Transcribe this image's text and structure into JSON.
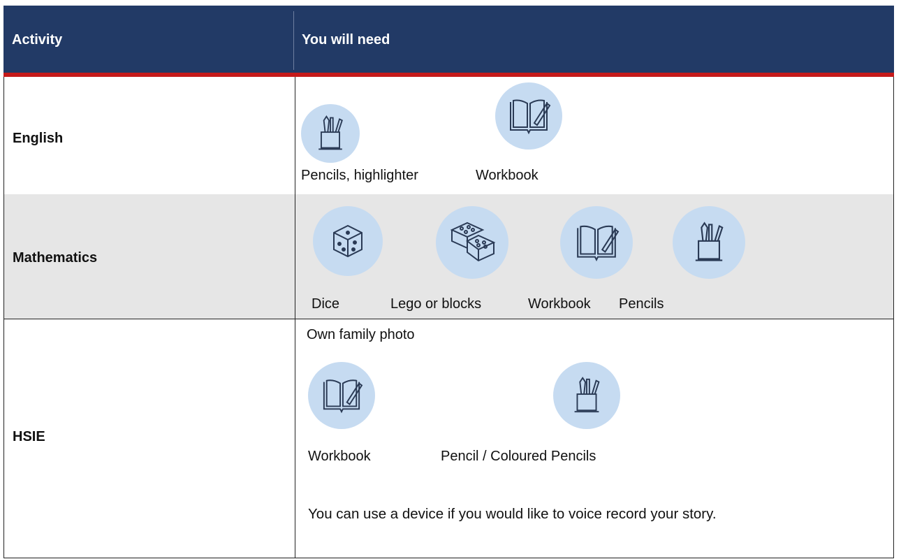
{
  "header": {
    "col1": "Activity",
    "col2": "You will need"
  },
  "rows": [
    {
      "subject": "English",
      "items": [
        {
          "icon": "pencil-cup-icon",
          "label": "Pencils, highlighter"
        },
        {
          "icon": "workbook-icon",
          "label": "Workbook"
        }
      ]
    },
    {
      "subject": "Mathematics",
      "items": [
        {
          "icon": "dice-icon",
          "label": "Dice"
        },
        {
          "icon": "lego-blocks-icon",
          "label": "Lego or blocks"
        },
        {
          "icon": "workbook-icon",
          "label": "Workbook"
        },
        {
          "icon": "pencil-cup-icon",
          "label": "Pencils"
        }
      ]
    },
    {
      "subject": "HSIE",
      "intro": "Own family photo",
      "items": [
        {
          "icon": "workbook-icon",
          "label": "Workbook"
        },
        {
          "icon": "pencil-cup-icon",
          "label": "Pencil / Coloured Pencils"
        }
      ],
      "note": "You can use a device if you would like to voice record your story."
    }
  ],
  "colors": {
    "header_bg": "#223a66",
    "accent_red": "#c51a1a",
    "icon_bg": "#c6dbf1",
    "row_grey": "#e6e6e6"
  }
}
